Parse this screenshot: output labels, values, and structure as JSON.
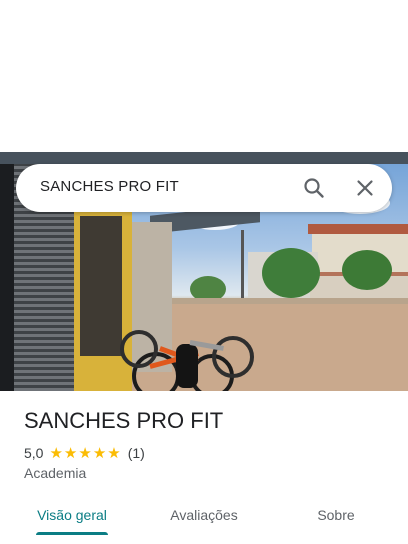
{
  "search": {
    "query": "SANCHES PRO FIT",
    "search_icon": "search-icon",
    "close_icon": "close-icon"
  },
  "place": {
    "name": "SANCHES PRO FIT",
    "rating": "5,0",
    "stars": 5,
    "review_count": "(1)",
    "category": "Academia"
  },
  "tabs": [
    {
      "label": "Visão geral",
      "active": true
    },
    {
      "label": "Avaliações",
      "active": false
    },
    {
      "label": "Sobre",
      "active": false
    }
  ],
  "colors": {
    "accent": "#0b7d84",
    "star": "#fbbc04"
  }
}
